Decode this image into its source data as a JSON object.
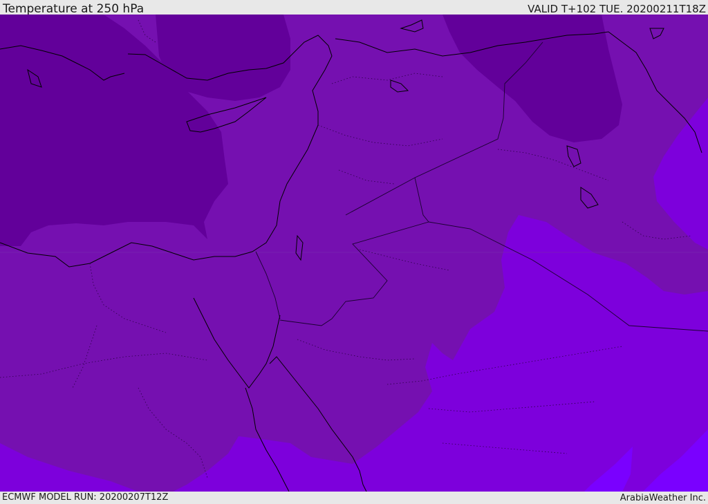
{
  "header": {
    "title": "Temperature at 250 hPa",
    "valid_time": "VALID T+102 TUE. 20200211T18Z"
  },
  "footer": {
    "model_run": "ECMWF MODEL RUN: 20200207T12Z",
    "credit": "ArabiaWeather Inc."
  },
  "colors": {
    "coldest": "#62009a",
    "cold": "#7510b0",
    "mid": "#7d00dc",
    "warm": "#8a00f5",
    "warmest": "#7a00ff",
    "coast": "#000000",
    "bar_bg": "#e8e8e8"
  }
}
